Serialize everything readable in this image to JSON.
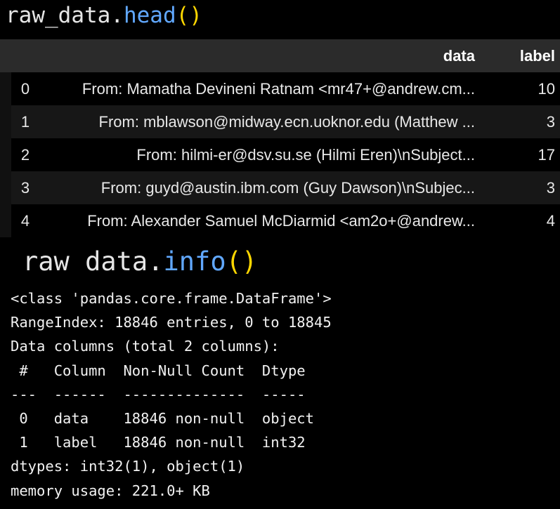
{
  "cell1": {
    "variable": "raw_data",
    "dot": ".",
    "method": "head",
    "parens": "()"
  },
  "table": {
    "columns": [
      "data",
      "label"
    ],
    "rows": [
      {
        "index": "0",
        "data": "From: Mamatha Devineni Ratnam <mr47+@andrew.cm...",
        "label": "10"
      },
      {
        "index": "1",
        "data": "From: mblawson@midway.ecn.uoknor.edu (Matthew ...",
        "label": "3"
      },
      {
        "index": "2",
        "data": "From: hilmi-er@dsv.su.se (Hilmi Eren)\\nSubject...",
        "label": "17"
      },
      {
        "index": "3",
        "data": "From: guyd@austin.ibm.com (Guy Dawson)\\nSubjec...",
        "label": "3"
      },
      {
        "index": "4",
        "data": "From: Alexander Samuel McDiarmid <am2o+@andrew...",
        "label": "4"
      }
    ]
  },
  "cell2": {
    "variable": "raw_data",
    "dot": ".",
    "method": "info",
    "parens": "()"
  },
  "info_output": {
    "lines": [
      "<class 'pandas.core.frame.DataFrame'>",
      "RangeIndex: 18846 entries, 0 to 18845",
      "Data columns (total 2 columns):",
      " #   Column  Non-Null Count  Dtype ",
      "---  ------  --------------  ----- ",
      " 0   data    18846 non-null  object",
      " 1   label   18846 non-null  int32 ",
      "dtypes: int32(1), object(1)",
      "memory usage: 221.0+ KB"
    ]
  }
}
